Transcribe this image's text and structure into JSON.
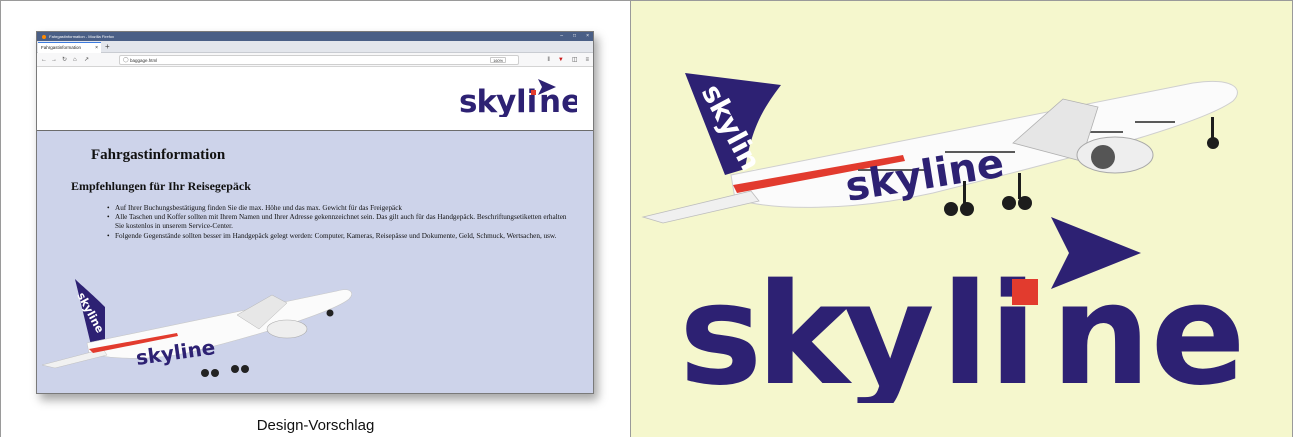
{
  "browser": {
    "window_title": "Fahrgastinformation - Mozilla Firefox",
    "window_controls": [
      "–",
      "□",
      "×"
    ],
    "tab_label": "Fahrgastinformation",
    "tab_close": "×",
    "new_tab": "+",
    "url": "baggage.html",
    "zoom": "160%",
    "nav_icons": [
      "back-icon",
      "forward-icon",
      "reload-icon",
      "home-icon",
      "tools-icon"
    ],
    "toolbar_icons": [
      "library-icon",
      "ublock-icon",
      "sidebar-icon",
      "menu-icon"
    ]
  },
  "page": {
    "logo_text": {
      "sky": "sky",
      "li": "li",
      "ne": "ne"
    },
    "title": "Fahrgastinformation",
    "subtitle": "Empfehlungen für Ihr Reisegepäck",
    "list": [
      "Auf Ihrer Buchungsbestätigung finden Sie die max. Höhe und das max. Gewicht für das Freigepäck",
      "Alle Taschen und Koffer sollten mit Ihrem Namen und Ihrer Adresse gekennzeichnet sein. Das gilt auch für das Handgepäck. Beschriftungsetiketten erhalten Sie kostenlos in unserem Service-Center.",
      "Folgende Gegenstände sollten besser im Handgepäck gelegt werden: Computer, Kameras, Reisepässe und Dokumente, Geld, Schmuck, Wertsachen, usw."
    ]
  },
  "caption": "Design-Vorschlag",
  "brand": {
    "logo_text": {
      "sky": "sky",
      "li": "li",
      "ne": "ne"
    },
    "tail_text": "skyline",
    "fuselage_text": "skyline"
  },
  "colors": {
    "brand_navy": "#2d2173",
    "brand_red": "#e23b2e",
    "page_body_bg": "#cdd3ea",
    "right_panel_bg": "#f5f7cd",
    "titlebar": "#4a5f86"
  }
}
